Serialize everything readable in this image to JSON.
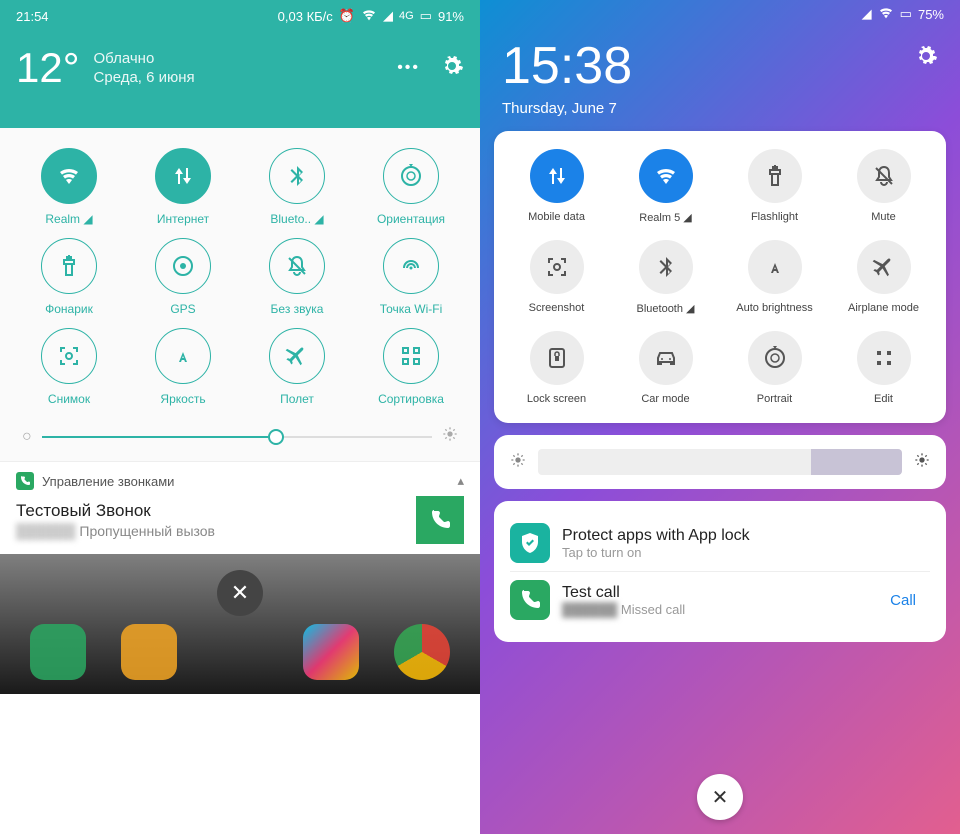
{
  "left": {
    "status": {
      "time": "21:54",
      "data_rate": "0,03 КБ/c",
      "battery": "91%"
    },
    "weather": {
      "temp": "12°",
      "condition": "Облачно",
      "date": "Среда, 6 июня"
    },
    "toggles": [
      {
        "label": "Realm ◢",
        "icon": "wifi",
        "active": true
      },
      {
        "label": "Интернет",
        "icon": "data",
        "active": true
      },
      {
        "label": "Blueto.. ◢",
        "icon": "bluetooth",
        "active": false
      },
      {
        "label": "Ориентация",
        "icon": "rotate",
        "active": false
      },
      {
        "label": "Фонарик",
        "icon": "flashlight",
        "active": false
      },
      {
        "label": "GPS",
        "icon": "gps",
        "active": false
      },
      {
        "label": "Без звука",
        "icon": "mute",
        "active": false
      },
      {
        "label": "Точка Wi-Fi",
        "icon": "hotspot",
        "active": false
      },
      {
        "label": "Снимок",
        "icon": "screenshot",
        "active": false
      },
      {
        "label": "Яркость",
        "icon": "brightness-auto",
        "active": false
      },
      {
        "label": "Полет",
        "icon": "airplane",
        "active": false
      },
      {
        "label": "Сортировка",
        "icon": "sort",
        "active": false
      }
    ],
    "notif": {
      "header": "Управление звонками",
      "title": "Тестовый Звонок",
      "sub": "Пропущенный вызов"
    }
  },
  "right": {
    "status": {
      "battery": "75%"
    },
    "header": {
      "time": "15:38",
      "date": "Thursday, June 7"
    },
    "toggles": [
      {
        "label": "Mobile data",
        "icon": "data",
        "active": true
      },
      {
        "label": "Realm 5 ◢",
        "icon": "wifi",
        "active": true
      },
      {
        "label": "Flashlight",
        "icon": "flashlight",
        "active": false
      },
      {
        "label": "Mute",
        "icon": "mute",
        "active": false
      },
      {
        "label": "Screenshot",
        "icon": "screenshot",
        "active": false
      },
      {
        "label": "Bluetooth ◢",
        "icon": "bluetooth",
        "active": false
      },
      {
        "label": "Auto brightness",
        "icon": "brightness-auto",
        "active": false
      },
      {
        "label": "Airplane mode",
        "icon": "airplane",
        "active": false
      },
      {
        "label": "Lock screen",
        "icon": "lock",
        "active": false
      },
      {
        "label": "Car mode",
        "icon": "car",
        "active": false
      },
      {
        "label": "Portrait",
        "icon": "rotate",
        "active": false
      },
      {
        "label": "Edit",
        "icon": "edit",
        "active": false
      }
    ],
    "notifs": {
      "applock": {
        "title": "Protect apps with App lock",
        "sub": "Tap to turn on"
      },
      "call": {
        "title": "Test call",
        "sub": "Missed call",
        "action": "Call"
      }
    }
  }
}
